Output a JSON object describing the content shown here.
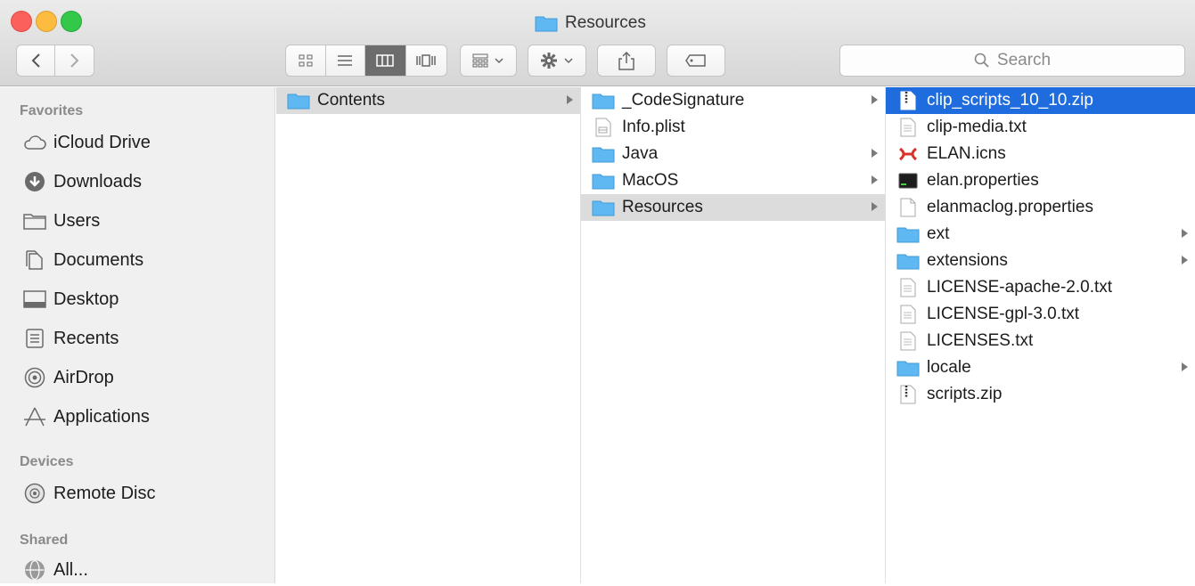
{
  "window": {
    "title": "Resources"
  },
  "toolbar": {
    "search_placeholder": "Search"
  },
  "sidebar": {
    "favorites_header": "Favorites",
    "devices_header": "Devices",
    "shared_header": "Shared",
    "favorites": [
      {
        "label": "iCloud Drive",
        "icon": "cloud-icon"
      },
      {
        "label": "Downloads",
        "icon": "download-icon"
      },
      {
        "label": "Users",
        "icon": "folder-icon"
      },
      {
        "label": "Documents",
        "icon": "documents-icon"
      },
      {
        "label": "Desktop",
        "icon": "desktop-icon"
      },
      {
        "label": "Recents",
        "icon": "recents-icon"
      },
      {
        "label": "AirDrop",
        "icon": "airdrop-icon"
      },
      {
        "label": "Applications",
        "icon": "applications-icon"
      }
    ],
    "devices": [
      {
        "label": "Remote Disc",
        "icon": "disc-icon"
      }
    ],
    "shared": [
      {
        "label": "All...",
        "icon": "network-icon"
      }
    ]
  },
  "columns": {
    "col1": [
      {
        "label": "Contents",
        "type": "folder",
        "arrow": true,
        "state": "gray"
      }
    ],
    "col2": [
      {
        "label": "_CodeSignature",
        "type": "folder",
        "arrow": true
      },
      {
        "label": "Info.plist",
        "type": "plist",
        "arrow": false
      },
      {
        "label": "Java",
        "type": "folder",
        "arrow": true
      },
      {
        "label": "MacOS",
        "type": "folder",
        "arrow": true
      },
      {
        "label": "Resources",
        "type": "folder",
        "arrow": true,
        "state": "gray"
      }
    ],
    "col3": [
      {
        "label": "clip_scripts_10_10.zip",
        "type": "zip",
        "arrow": false,
        "state": "blue"
      },
      {
        "label": "clip-media.txt",
        "type": "text",
        "arrow": false
      },
      {
        "label": "ELAN.icns",
        "type": "icns",
        "arrow": false
      },
      {
        "label": "elan.properties",
        "type": "terminal",
        "arrow": false
      },
      {
        "label": "elanmaclog.properties",
        "type": "blank",
        "arrow": false
      },
      {
        "label": "ext",
        "type": "folder",
        "arrow": true
      },
      {
        "label": "extensions",
        "type": "folder",
        "arrow": true
      },
      {
        "label": "LICENSE-apache-2.0.txt",
        "type": "text",
        "arrow": false
      },
      {
        "label": "LICENSE-gpl-3.0.txt",
        "type": "text",
        "arrow": false
      },
      {
        "label": "LICENSES.txt",
        "type": "text",
        "arrow": false
      },
      {
        "label": "locale",
        "type": "folder",
        "arrow": true
      },
      {
        "label": "scripts.zip",
        "type": "zip",
        "arrow": false
      }
    ]
  },
  "colors": {
    "selection": "#1f6cde",
    "folder": "#5fb8f2",
    "sidebar_bg": "#f0f0f0"
  }
}
